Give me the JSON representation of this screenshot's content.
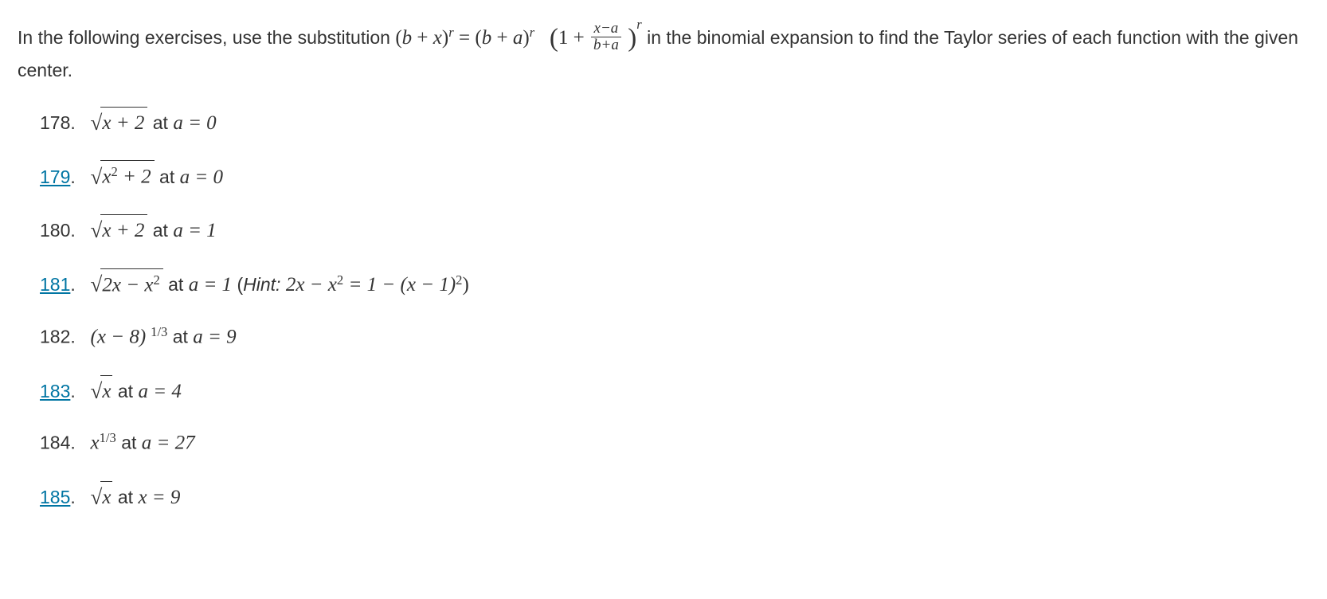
{
  "intro": {
    "prefix": "In the following exercises, use the substitution ",
    "suffix": " in the binomial expansion to find the Taylor series of each function with the given center."
  },
  "formula": {
    "lhs_b": "b",
    "lhs_x": "x",
    "lhs_exp": "r",
    "rhs_b": "b",
    "rhs_a": "a",
    "rhs_exp1": "r",
    "one": "1",
    "frac_num": "x−a",
    "frac_den": "b+a",
    "rhs_exp2": "r",
    "plus": "+",
    "eq": "="
  },
  "ex": [
    {
      "num": "178",
      "link": false,
      "center": "a = 0",
      "type": "sqrt",
      "radicand": "x + 2"
    },
    {
      "num": "179",
      "link": true,
      "center": "a = 0",
      "type": "sqrt_sq",
      "radicand_pre": "x",
      "radicand_sup": "2",
      "radicand_post": " + 2"
    },
    {
      "num": "180",
      "link": false,
      "center": "a = 1",
      "type": "sqrt",
      "radicand": "x + 2"
    },
    {
      "num": "181",
      "link": true,
      "center": "a = 1",
      "type": "sqrt_poly",
      "radicand": "2x − x",
      "radicand_sup": "2",
      "hint_label": "Hint:",
      "hint_lhs": "2x − x",
      "hint_lhs_sup": "2",
      "hint_eq": " = 1 − (x − 1)",
      "hint_rhs_sup": "2"
    },
    {
      "num": "182",
      "link": false,
      "center": "a = 9",
      "type": "paren_pow",
      "base": "(x − 8)",
      "exp": "1/3"
    },
    {
      "num": "183",
      "link": true,
      "center": "a = 4",
      "type": "sqrt_short",
      "radicand": "x"
    },
    {
      "num": "184",
      "link": false,
      "center": "a = 27",
      "type": "x_pow",
      "base": "x",
      "exp": "1/3"
    },
    {
      "num": "185",
      "link": true,
      "center": "x = 9",
      "type": "sqrt_short",
      "radicand": "x"
    }
  ],
  "at": " at "
}
